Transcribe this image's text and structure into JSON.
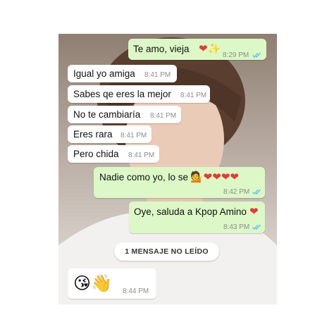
{
  "colors": {
    "incoming_bubble": "#ffffff",
    "outgoing_bubble": "#dcf8c6",
    "read_ticks": "#4fc3f7",
    "heart": "#e53935"
  },
  "messages": [
    {
      "direction": "out",
      "text": "Te amo, vieja",
      "emoji": "❤✨",
      "time": "8:29 PM",
      "ticks": "double-check-read"
    },
    {
      "direction": "in",
      "text": "Igual yo amiga",
      "time": "8:41 PM"
    },
    {
      "direction": "in",
      "text": "Sabes qe eres la mejor",
      "time": "8:41 PM"
    },
    {
      "direction": "in",
      "text": "No te cambiaría",
      "time": "8:41 PM"
    },
    {
      "direction": "in",
      "text": "Eres rara",
      "time": "8:41 PM"
    },
    {
      "direction": "in",
      "text": "Pero chida",
      "time": "8:41 PM"
    },
    {
      "direction": "out",
      "text": "Nadie como yo, lo se",
      "emoji": "💁❤❤❤❤",
      "time": "8:42 PM",
      "ticks": "double-check-read"
    },
    {
      "direction": "out",
      "text": "Oye, saluda a Kpop Amino",
      "emoji": "❤",
      "time": "8:43 PM",
      "ticks": "double-check-read"
    },
    {
      "direction": "in",
      "emoji": "😘👋",
      "time": "8:44 PM"
    }
  ],
  "unread_divider": "1 MENSAJE NO LEÍDO"
}
